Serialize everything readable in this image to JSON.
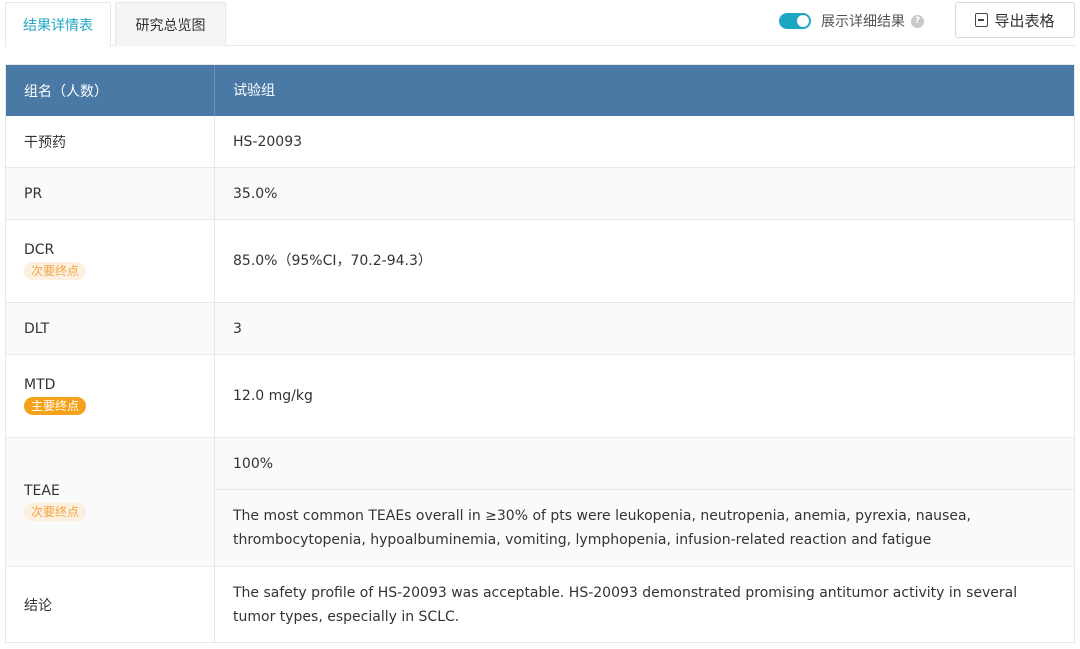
{
  "tabs": [
    {
      "label": "结果详情表",
      "active": true
    },
    {
      "label": "研究总览图",
      "active": false
    }
  ],
  "toolbar": {
    "toggle_label": "展示详细结果",
    "toggle_on": true,
    "help_glyph": "?",
    "export_label": "导出表格"
  },
  "colors": {
    "accent": "#1ea7c5",
    "header_bg": "#4a79a6",
    "secondary_badge_text": "#f0a640",
    "primary_badge_bg": "#f5a21b"
  },
  "table": {
    "header": {
      "col1": "组名（人数）",
      "col2": "试验组"
    },
    "rows": [
      {
        "label": "干预药",
        "value": "HS-20093"
      },
      {
        "label": "PR",
        "value": "35.0%"
      },
      {
        "label": "DCR",
        "badge": "次要终点",
        "value": "85.0%（95%CI，70.2-94.3）"
      },
      {
        "label": "DLT",
        "value": "3"
      },
      {
        "label": "MTD",
        "badge": "主要终点",
        "value": "12.0 mg/kg"
      },
      {
        "label": "TEAE",
        "badge": "次要终点",
        "values": [
          "100%",
          "The most common TEAEs overall in ≥30% of pts were leukopenia, neutropenia, anemia, pyrexia, nausea, thrombocytopenia, hypoalbuminemia, vomiting, lymphopenia, infusion-related reaction and fatigue"
        ]
      },
      {
        "label": "结论",
        "value": "The safety profile of HS-20093 was acceptable. HS-20093 demonstrated promising antitumor activity in several tumor types, especially in SCLC."
      }
    ]
  }
}
